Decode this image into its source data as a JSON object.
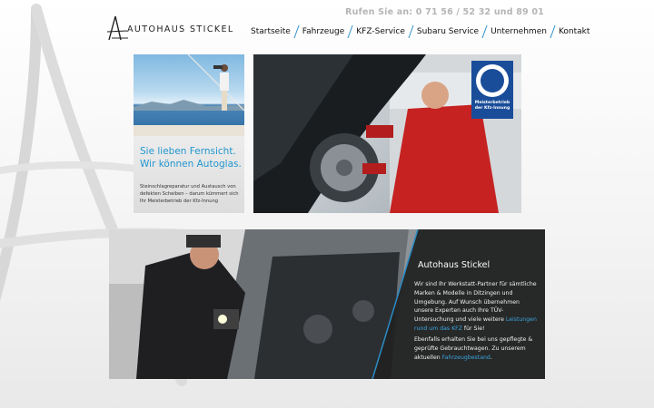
{
  "header": {
    "phone": "Rufen Sie an: 0 71 56 / 52 32 und 89 01",
    "logo_text": "AUTOHAUS STICKEL"
  },
  "nav": {
    "items": [
      {
        "label": "Startseite"
      },
      {
        "label": "Fahrzeuge"
      },
      {
        "label": "KFZ-Service"
      },
      {
        "label": "Subaru Service"
      },
      {
        "label": "Unternehmen"
      },
      {
        "label": "Kontakt"
      }
    ]
  },
  "teaser": {
    "headline_1": "Sie lieben Fernsicht.",
    "headline_2": "Wir können Autoglas.",
    "text": "Steinschlagreparatur und Austausch von defekten Scheiben – darum kümmert sich Ihr Meisterbetrieb der Kfz-Innung"
  },
  "badge": {
    "line1": "Meisterbetrieb",
    "line2": "der Kfz-Innung"
  },
  "panel": {
    "title": "Autohaus Stickel",
    "p1_text": "Wir sind Ihr Werkstatt-Partner für sämtliche Marken & Modelle in Ditzingen und Umgebung. Auf Wunsch übernehmen unsere Experten auch Ihre TÜV-Untersuchung und viele weitere ",
    "p1_link": "Leistungen rund um das KFZ",
    "p1_end": " für Sie!",
    "p2_text": "Ebenfalls erhalten Sie bei uns gepflegte & geprüfte Gebrauchtwagen. Zu unserem aktuellen ",
    "p2_link": "Fahrzeugbestand",
    "p2_end": "."
  },
  "colors": {
    "accent": "#2a8cc7",
    "link": "#3aa6e0",
    "badge": "#1a4d99"
  }
}
